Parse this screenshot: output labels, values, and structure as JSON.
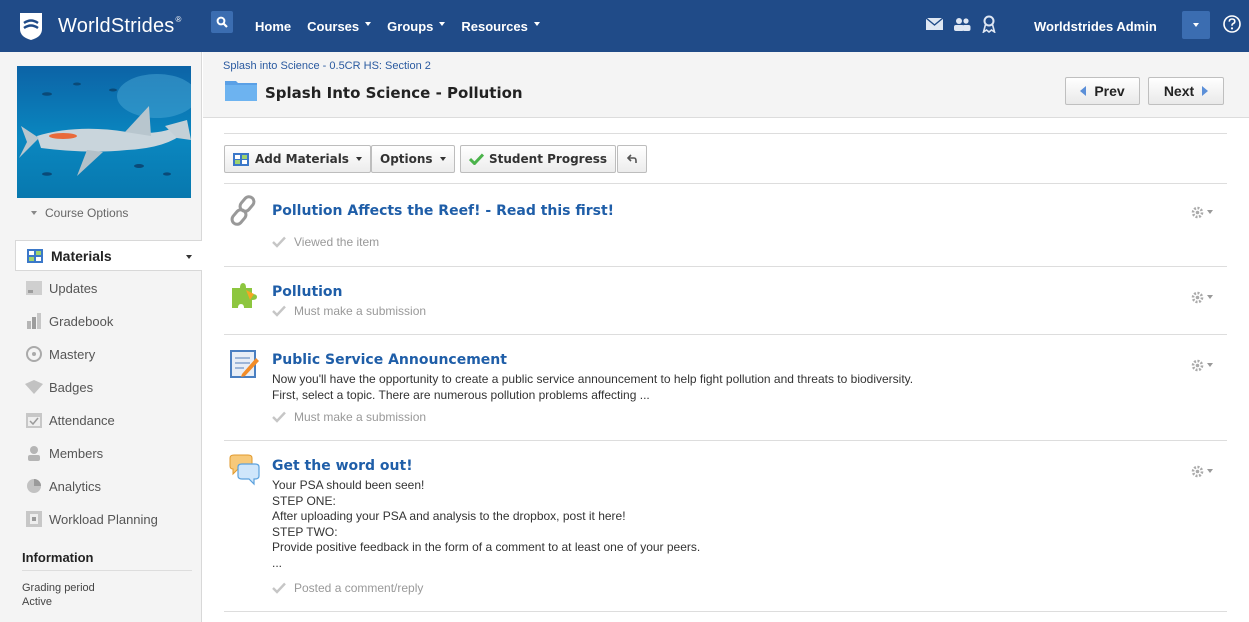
{
  "brand": {
    "name": "WorldStrides",
    "mark": "®"
  },
  "topnav": {
    "items": [
      {
        "label": "Home"
      },
      {
        "label": "Courses"
      },
      {
        "label": "Groups"
      },
      {
        "label": "Resources"
      }
    ],
    "user": "Worldstrides Admin",
    "icons": [
      "search-icon",
      "mail-icon",
      "people-icon",
      "badge-icon",
      "help-icon"
    ]
  },
  "sidebar": {
    "course_options": "Course Options",
    "active": "Materials",
    "items": [
      {
        "label": "Updates",
        "icon": "updates-icon"
      },
      {
        "label": "Gradebook",
        "icon": "gradebook-icon"
      },
      {
        "label": "Mastery",
        "icon": "mastery-icon"
      },
      {
        "label": "Badges",
        "icon": "badges-icon"
      },
      {
        "label": "Attendance",
        "icon": "attendance-icon"
      },
      {
        "label": "Members",
        "icon": "members-icon"
      },
      {
        "label": "Analytics",
        "icon": "analytics-icon"
      },
      {
        "label": "Workload Planning",
        "icon": "workload-icon"
      }
    ],
    "information": {
      "title": "Information",
      "grading_label": "Grading period",
      "grading_value": "Active"
    }
  },
  "header": {
    "breadcrumb": "Splash into Science - 0.5CR HS: Section 2",
    "title": "Splash Into Science - Pollution",
    "prev": "Prev",
    "next": "Next"
  },
  "toolbar": {
    "add_materials": "Add Materials",
    "options": "Options",
    "student_progress": "Student Progress"
  },
  "materials": [
    {
      "title": "Pollution Affects the Reef! - Read this first!",
      "icon": "link-icon",
      "desc": [],
      "status": "Viewed the item"
    },
    {
      "title": "Pollution",
      "icon": "assignment-icon",
      "desc": [],
      "status": "Must make a submission"
    },
    {
      "title": "Public Service Announcement",
      "icon": "assignment-edit-icon",
      "desc": [
        "Now you'll have the opportunity to create a public service announcement to help fight pollution and threats to biodiversity.",
        "First, select a topic. There are numerous pollution problems affecting ..."
      ],
      "status": "Must make a submission"
    },
    {
      "title": "Get the word out!",
      "icon": "discussion-icon",
      "desc": [
        "Your PSA should been seen!",
        "STEP ONE:",
        "After uploading your PSA and analysis to the dropbox, post it here!",
        "STEP TWO:",
        "Provide positive feedback in the form of a comment to at least one of your peers.",
        "..."
      ],
      "status": "Posted a comment/reply"
    }
  ],
  "colors": {
    "topbar": "#204b88",
    "link": "#1f5ea8",
    "accent": "#5b8fd8"
  }
}
